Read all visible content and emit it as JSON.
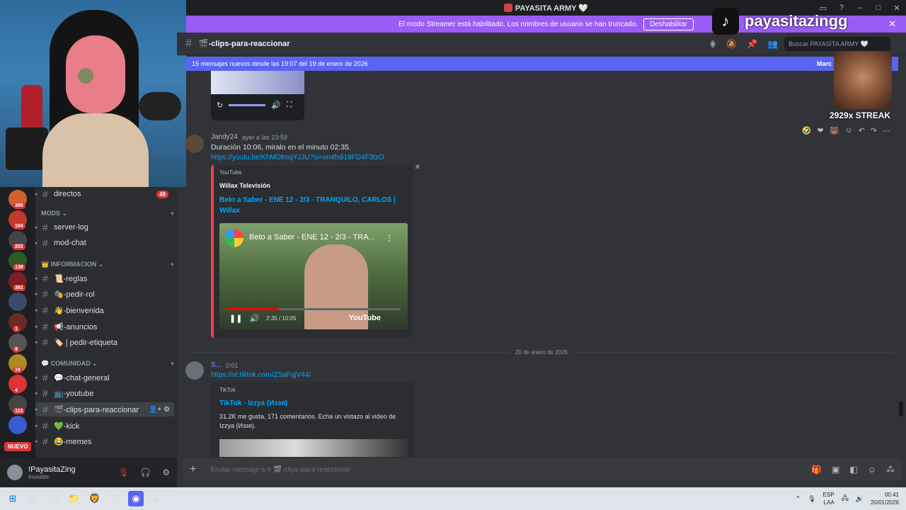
{
  "window": {
    "title": "PAYASITA ARMY 🤍"
  },
  "streamer_banner": {
    "text": "El modo Streamer está habilitado. Los nombres de usuario se han truncado.",
    "button": "Deshabilitar"
  },
  "overlay": {
    "tiktok_handle": "payasitazingg",
    "streak": "2929x STREAK"
  },
  "servers": [
    {
      "badge": "396",
      "color": "#d06030"
    },
    {
      "badge": "194",
      "color": "#c0392b"
    },
    {
      "badge": "202",
      "color": "#444"
    },
    {
      "badge": "139",
      "color": "#2d5a27"
    },
    {
      "badge": "361",
      "color": "#7a1f1f"
    },
    {
      "badge": "",
      "color": "#3a4a6a"
    },
    {
      "badge": "1",
      "color": "#6a2a2a"
    },
    {
      "badge": "9",
      "color": "#555"
    },
    {
      "badge": "19",
      "color": "#b08a20"
    },
    {
      "badge": "4",
      "color": "#d33"
    },
    {
      "badge": "113",
      "color": "#444"
    },
    {
      "badge": "",
      "color": "#3a5ad0"
    }
  ],
  "server_rail": {
    "new_label": "NUEVO"
  },
  "channels": {
    "top": {
      "name": "directos",
      "unread": "49"
    },
    "categories": [
      {
        "label": "MODS",
        "items": [
          "server-log",
          "mod-chat"
        ]
      },
      {
        "label": "👑 INFORMACION",
        "items": [
          "📜-reglas",
          "🎭-pedir-rol",
          "👋-bienvenida",
          "📢-anuncios",
          "🏷️ | pedir-etiqueta"
        ]
      },
      {
        "label": "💬 COMUNIDAD",
        "items": [
          "💬-chat-general",
          "📺-youtube",
          "🎬-clips-para-reaccionar",
          "💚-kick",
          "😂-memes"
        ]
      }
    ]
  },
  "user": {
    "name": "!PayasitaZing",
    "status": "Invisible"
  },
  "chat": {
    "channel": "🎬-clips-para-reaccionar",
    "search_placeholder": "Buscar PAYASITA ARMY 🤍",
    "new_messages": "15 mensajes nuevos desde las 19:07 del 19 de enero de 2026",
    "mark_read": "Marc",
    "composer_placeholder": "Enviar mensaje a # 🎬-clips-para-reaccionar"
  },
  "messages": [
    {
      "author": "Jandy24",
      "time": "ayer a las 23:59",
      "text": "Duración 10:06, miralo en el minuto 02:35.",
      "link": "https://youtu.be/KhMDfmqYJJU?si=xn4fs619FD4F3tzO",
      "embed": {
        "provider": "YouTube",
        "author": "Willax Televisión",
        "title": "Beto a Saber - ENE 12 - 2/3 - TRANQUILO, CARLOS | Willax",
        "video_title": "Beto a Saber - ENE 12 - 2/3 - TRA...",
        "time": "2:35 / 10:05",
        "brand": "YouTube"
      }
    },
    {
      "author": "S...",
      "time": "0:01",
      "link": "https://vt.tiktok.com/ZSaFqjV44/",
      "embed": {
        "provider": "TikTok",
        "title": "TikTok · Izzya (Иззя)",
        "desc": "31.2K me gusta, 171 comentarios. Echa un vistazo al video de Izzya (Иззя)."
      }
    }
  ],
  "date_divider": "20 de enero de 2026",
  "taskbar": {
    "lang": "ESP",
    "lang2": "LAA",
    "time": "00:41",
    "date": "20/01/2026"
  }
}
